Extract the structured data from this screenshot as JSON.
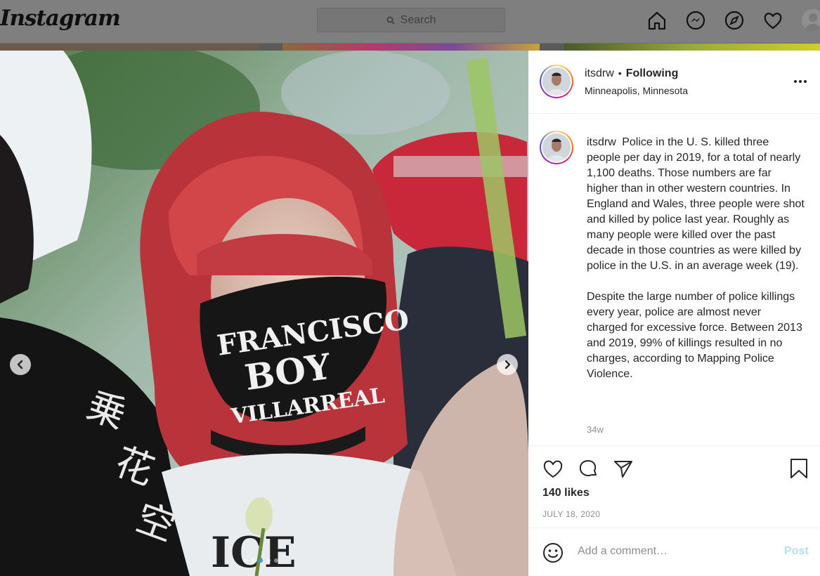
{
  "nav": {
    "logo": "Instagram",
    "search_placeholder": "Search",
    "icons": [
      "home-icon",
      "messenger-icon",
      "explore-icon",
      "activity-heart-icon",
      "profile-avatar"
    ]
  },
  "post": {
    "carousel": {
      "prev_icon": "chevron-left-icon",
      "next_icon": "chevron-right-icon",
      "slide_count": 5,
      "active_slide": 3
    },
    "header": {
      "username": "itsdrw",
      "separator": "•",
      "follow_status": "Following",
      "location": "Minneapolis, Minnesota",
      "more_icon": "more-options-icon"
    },
    "caption": {
      "username": "itsdrw",
      "paragraph1": "Police in the U. S. killed three people per day in 2019, for a total of nearly 1,100 deaths. Those numbers are far higher than in other western countries. In England and Wales, three people were shot and killed by police last year. Roughly as many people were killed over the past decade in those countries as were killed by police in the U.S. in an average week (19).",
      "paragraph2": "Despite the large number of police killings every year, police are almost never charged for excessive force. Between 2013 and 2019, 99% of killings resulted in no charges, according to Mapping Police Violence.",
      "age": "34w"
    },
    "actions": {
      "icons": [
        "like-heart-icon",
        "comment-icon",
        "share-icon",
        "save-bookmark-icon"
      ],
      "likes": "140 likes",
      "date": "JULY 18, 2020"
    },
    "comment": {
      "placeholder": "Add a comment…",
      "post_label": "Post",
      "emoji_icon": "emoji-icon"
    }
  },
  "colors": {
    "overlay_nav": "#7f7f7f",
    "link_disabled": "#b2dffc",
    "carousel_active_dot": "#3f96f0"
  }
}
